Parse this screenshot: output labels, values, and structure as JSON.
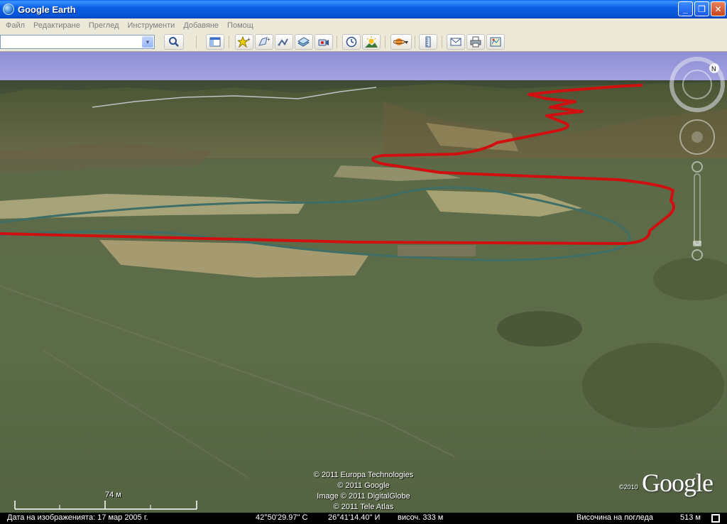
{
  "window": {
    "title": "Google Earth",
    "minimize_label": "_",
    "maximize_label": "❐",
    "close_label": "✕"
  },
  "menu": [
    "Файл",
    "Редактиране",
    "Преглед",
    "Инструменти",
    "Добавяне",
    "Помощ"
  ],
  "search": {
    "value": "",
    "placeholder": ""
  },
  "toolbar_icons": [
    "search-icon",
    "sidebar-toggle-icon",
    "add-placemark-icon",
    "add-polygon-icon",
    "add-path-icon",
    "add-image-overlay-icon",
    "record-tour-icon",
    "historical-imagery-icon",
    "sunlight-icon",
    "switch-to-sky-icon",
    "ruler-icon",
    "email-icon",
    "print-icon",
    "view-in-maps-icon"
  ],
  "colors": {
    "path_line": "#d01010",
    "sky_top": "#8e8ed6",
    "sky_bottom": "#b8b4e8",
    "river": "#3e6e66"
  },
  "credits": [
    "© 2011 Europa Technologies",
    "© 2011 Google",
    "Image © 2011 DigitalGlobe",
    "© 2011 Tele Atlas"
  ],
  "google_logo": "Google",
  "logo_copyright": "©2010",
  "scale_label": "74 м",
  "status": {
    "imagery_date": "Дата на изображенията: 17 мар 2005 г.",
    "latitude": "42°50'29.97\" С",
    "longitude": "26°41'14.40\" И",
    "elevation": "височ.  333 м",
    "eye_alt_label": "Височина на погледа",
    "eye_alt_value": "513 м"
  },
  "nav_controls": [
    "look-joystick",
    "move-joystick",
    "zoom-slider"
  ]
}
